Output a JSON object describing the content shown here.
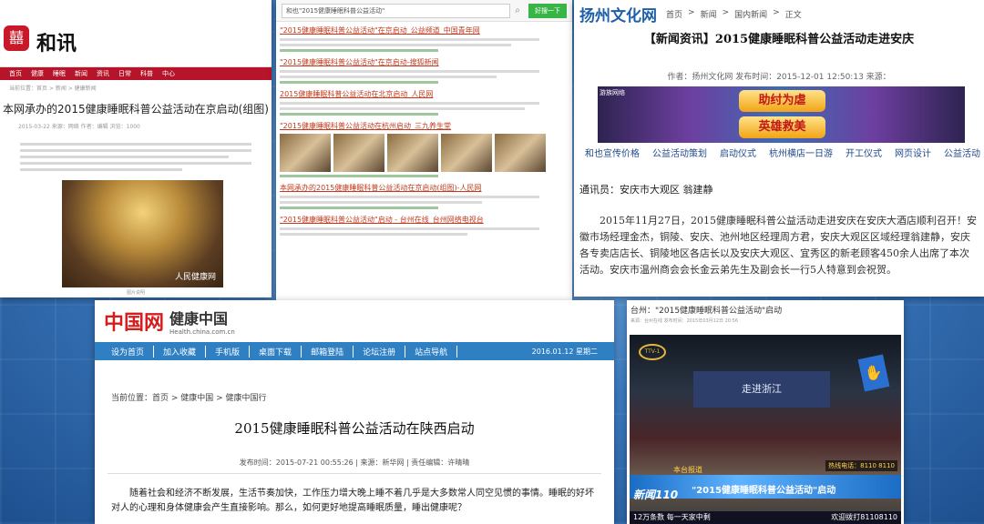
{
  "panel1": {
    "brand": "和讯",
    "logo_glyph": "囍",
    "nav": [
      "首页",
      "健康",
      "睡眠",
      "新闻",
      "资讯",
      "日常",
      "科普",
      "中心"
    ],
    "crumb": "当前位置：首页 > 新闻 > 健康新闻",
    "title": "本网承办的2015健康睡眠科普公益活动在京启动(组图)",
    "meta": "2015-03-22 来源：网络 作者：编辑 浏览：1000",
    "photo_caption": "人民健康网",
    "caption": "图片说明"
  },
  "panel2": {
    "search_value": "和也\"2015健康睡眠科普公益活动\"",
    "search_button": "好搜一下",
    "results": [
      "\"2015健康睡眠科普公益活动\"在京启动_公益频道_中国青年网",
      "\"2015健康睡眠科普公益活动\"在京启动-搜狐新闻",
      "2015健康睡眠科普公益活动在北京启动_人民网",
      "\"2015健康睡眠科普公益活动在杭州启动_三九养生堂",
      "本网承办的2015健康睡眠科普公益活动在京启动(组图)-人民网",
      "\"2015健康睡眠科普公益活动\"启动 - 台州在线_台州网络电视台"
    ]
  },
  "panel3": {
    "site": "扬州文化网",
    "crumbs": [
      "首页",
      "新闻",
      "国内新闻",
      "正文"
    ],
    "title": "【新闻资讯】2015健康睡眠科普公益活动走进安庆",
    "meta": "作者：扬州文化网    发布时间：2015-12-01 12:50:13    来源：",
    "banner_tag": "游族网络",
    "banner_btn1": "助纣为虐",
    "banner_btn2": "英雄救美",
    "links": [
      "和也宣传价格",
      "公益活动策划",
      "启动仪式",
      "杭州横店一日游",
      "开工仪式",
      "网页设计",
      "公益活动"
    ],
    "author": "通讯员：安庆市大观区   翁建静",
    "body": "2015年11月27日，2015健康睡眠科普公益活动走进安庆在安庆大酒店顺利召开！安徽市场经理金杰，铜陵、安庆、池州地区经理周方君，安庆大观区区域经理翁建静，安庆各专卖店店长、铜陵地区各店长以及安庆大观区、宜秀区的新老顾客450余人出席了本次活动。安庆市温州商会会长金云弟先生及副会长一行5人特意到会祝贺。"
  },
  "panel4": {
    "logo_a": "中国网",
    "logo_b": "健康中国",
    "url": "Health.china.com.cn",
    "nav": [
      "设为首页",
      "加入收藏",
      "手机版",
      "桌面下载",
      "邮箱登陆",
      "论坛注册",
      "站点导航"
    ],
    "date": "2016.01.12  星期二",
    "crumb": "当前位置：首页 > 健康中国 > 健康中国行",
    "title": "2015健康睡眠科普公益活动在陕西启动",
    "meta": "发布时间：2015-07-21 00:55:26  |  来源：新华网  |  责任编辑：许晴晴",
    "body": "随着社会和经济不断发展，生活节奏加快，工作压力增大晚上睡不着几乎是大多数常人同空见惯的事情。睡眠的好坏对人的心理和身体健康会产生直接影响。那么，如何更好地提高睡眠质量，睡出健康呢？"
  },
  "panel5": {
    "title": "台州：\"2015健康睡眠科普公益活动\"启动",
    "meta": "来源：台州在线  发布时间：2015年03月12日 20:56",
    "channel": "TTV-1",
    "stage": "走进浙江",
    "local": "本台报道",
    "hot": "热线电话：8110 8110",
    "program": "新闻110",
    "banner_text": "\"2015健康睡眠科普公益活动\"启动",
    "ticker_left": "12万条数  每一天家中剩",
    "ticker_right": "欢迎拨打81108110"
  },
  "colors": {
    "bg": "#3d7bc0",
    "nav_red": "#b6142a",
    "nav_blue": "#2f7fc3",
    "search_green": "#38b546",
    "link_red": "#c43a1e"
  }
}
